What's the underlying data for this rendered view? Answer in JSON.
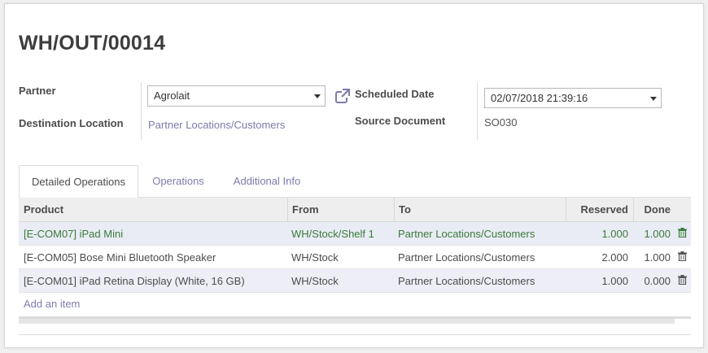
{
  "record": {
    "title": "WH/OUT/00014"
  },
  "fields": {
    "partner_label": "Partner",
    "partner_value": "Agrolait",
    "destination_label": "Destination Location",
    "destination_value": "Partner Locations/Customers",
    "scheduled_label": "Scheduled Date",
    "scheduled_value": "02/07/2018 21:39:16",
    "source_label": "Source Document",
    "source_value": "SO030"
  },
  "tabs": [
    {
      "label": "Detailed Operations",
      "active": true
    },
    {
      "label": "Operations",
      "active": false
    },
    {
      "label": "Additional Info",
      "active": false
    }
  ],
  "table": {
    "columns": [
      "Product",
      "From",
      "To",
      "Reserved",
      "Done"
    ],
    "rows": [
      {
        "product": "[E-COM07] iPad Mini",
        "from": "WH/Stock/Shelf 1",
        "to": "Partner Locations/Customers",
        "reserved": "1.000",
        "done": "1.000"
      },
      {
        "product": "[E-COM05] Bose Mini Bluetooth Speaker",
        "from": "WH/Stock",
        "to": "Partner Locations/Customers",
        "reserved": "2.000",
        "done": "1.000"
      },
      {
        "product": "[E-COM01] iPad Retina Display (White, 16 GB)",
        "from": "WH/Stock",
        "to": "Partner Locations/Customers",
        "reserved": "1.000",
        "done": "0.000"
      }
    ],
    "add_item_label": "Add an item"
  },
  "icons": {
    "external_link": "external-link-icon",
    "delete": "trash-icon",
    "dropdown": "caret-down-icon"
  },
  "colors": {
    "link": "#7c7bad",
    "highlight_text": "#3b7a3b",
    "row_highlight": "#eeeef7"
  }
}
